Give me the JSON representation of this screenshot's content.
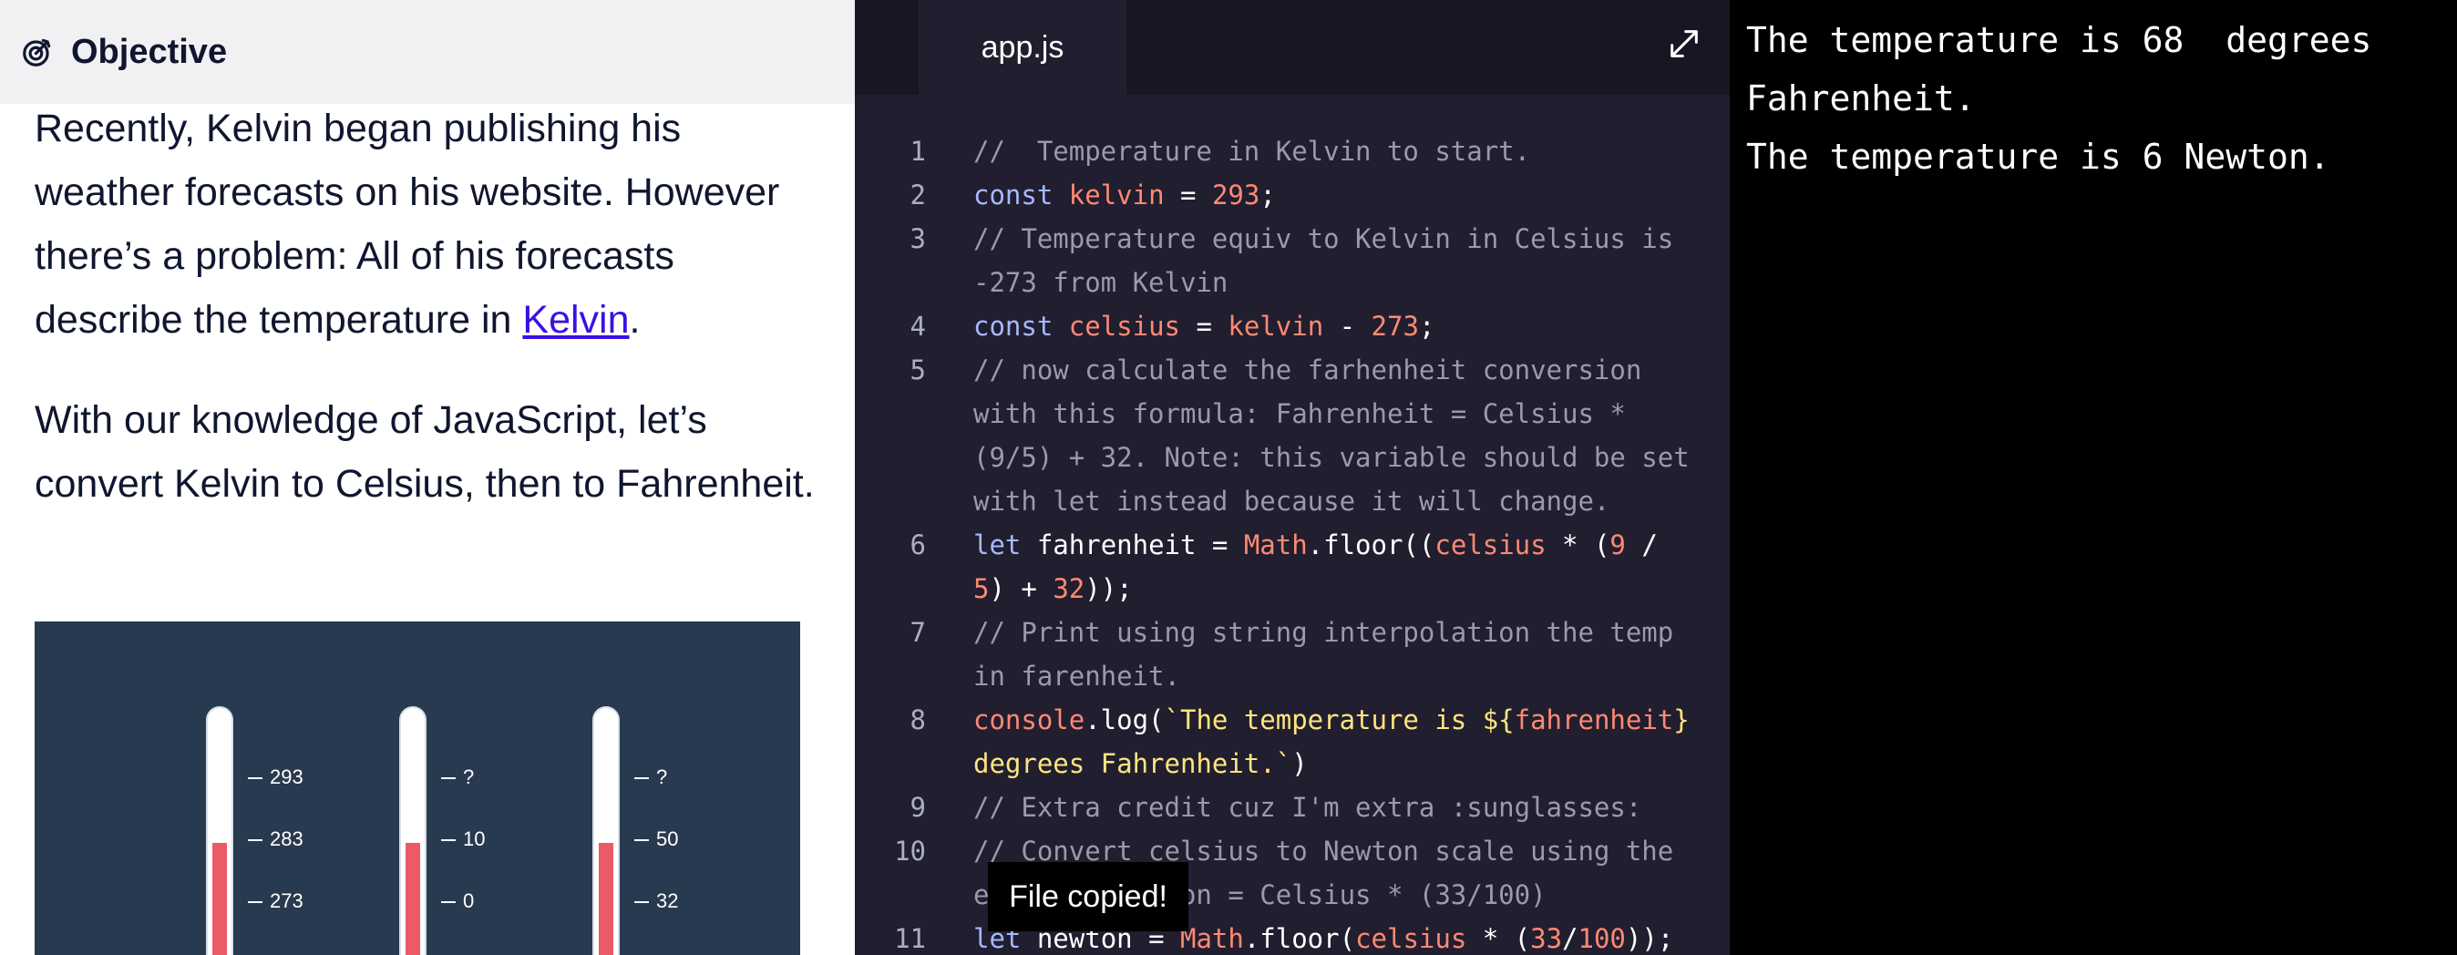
{
  "objective": {
    "title": "Objective",
    "icon": "target-icon"
  },
  "lesson": {
    "p1_before": "Recently, Kelvin began publishing his weather forecasts on his website. However there’s a problem: All of his forecasts describe the temperature in ",
    "p1_link": "Kelvin",
    "p1_after": ".",
    "p2": "With our knowledge of JavaScript, let’s convert Kelvin to Celsius, then to Fahrenheit."
  },
  "thermometers": [
    {
      "ticks": [
        "293",
        "283",
        "273"
      ],
      "fill_fraction": 0.5
    },
    {
      "ticks": [
        "?",
        "10",
        "0"
      ],
      "fill_fraction": 0.5
    },
    {
      "ticks": [
        "?",
        "50",
        "32"
      ],
      "fill_fraction": 0.5
    }
  ],
  "editor": {
    "tab": "app.js",
    "expand_icon": "expand-icon",
    "toast": "File copied!",
    "lines": [
      {
        "n": "1",
        "text": "//  Temperature in Kelvin to start."
      },
      {
        "n": "2",
        "text": "const kelvin = 293;"
      },
      {
        "n": "3",
        "text": "// Temperature equiv to Kelvin in Celsius is -273 from Kelvin"
      },
      {
        "n": "4",
        "text": "const celsius = kelvin - 273;"
      },
      {
        "n": "5",
        "text": "// now calculate the farhenheit conversion with this formula: Fahrenheit = Celsius * (9/5) + 32. Note: this variable should be set with let instead because it will change."
      },
      {
        "n": "6",
        "text": "let fahrenheit = Math.floor((celsius * (9 / 5) + 32));"
      },
      {
        "n": "7",
        "text": "// Print using string interpolation the temp in farenheit."
      },
      {
        "n": "8",
        "text": "console.log(`The temperature is ${fahrenheit} degrees Fahrenheit.`)"
      },
      {
        "n": "9",
        "text": "// Extra credit cuz I'm extra :sunglasses:"
      },
      {
        "n": "10",
        "text": "// Convert celsius to Newton scale using the equation Newton = Celsius * (33/100)"
      },
      {
        "n": "11",
        "text": "let newton = Math.floor(celsius * (33/100));"
      }
    ]
  },
  "output": {
    "lines": [
      "The temperature is 68  degrees Fahrenheit.",
      "The temperature is 6 Newton."
    ]
  },
  "colors": {
    "accent_link": "#3a10e5",
    "thermo_fill": "#ec5a66",
    "editor_bg": "#211e2f"
  }
}
